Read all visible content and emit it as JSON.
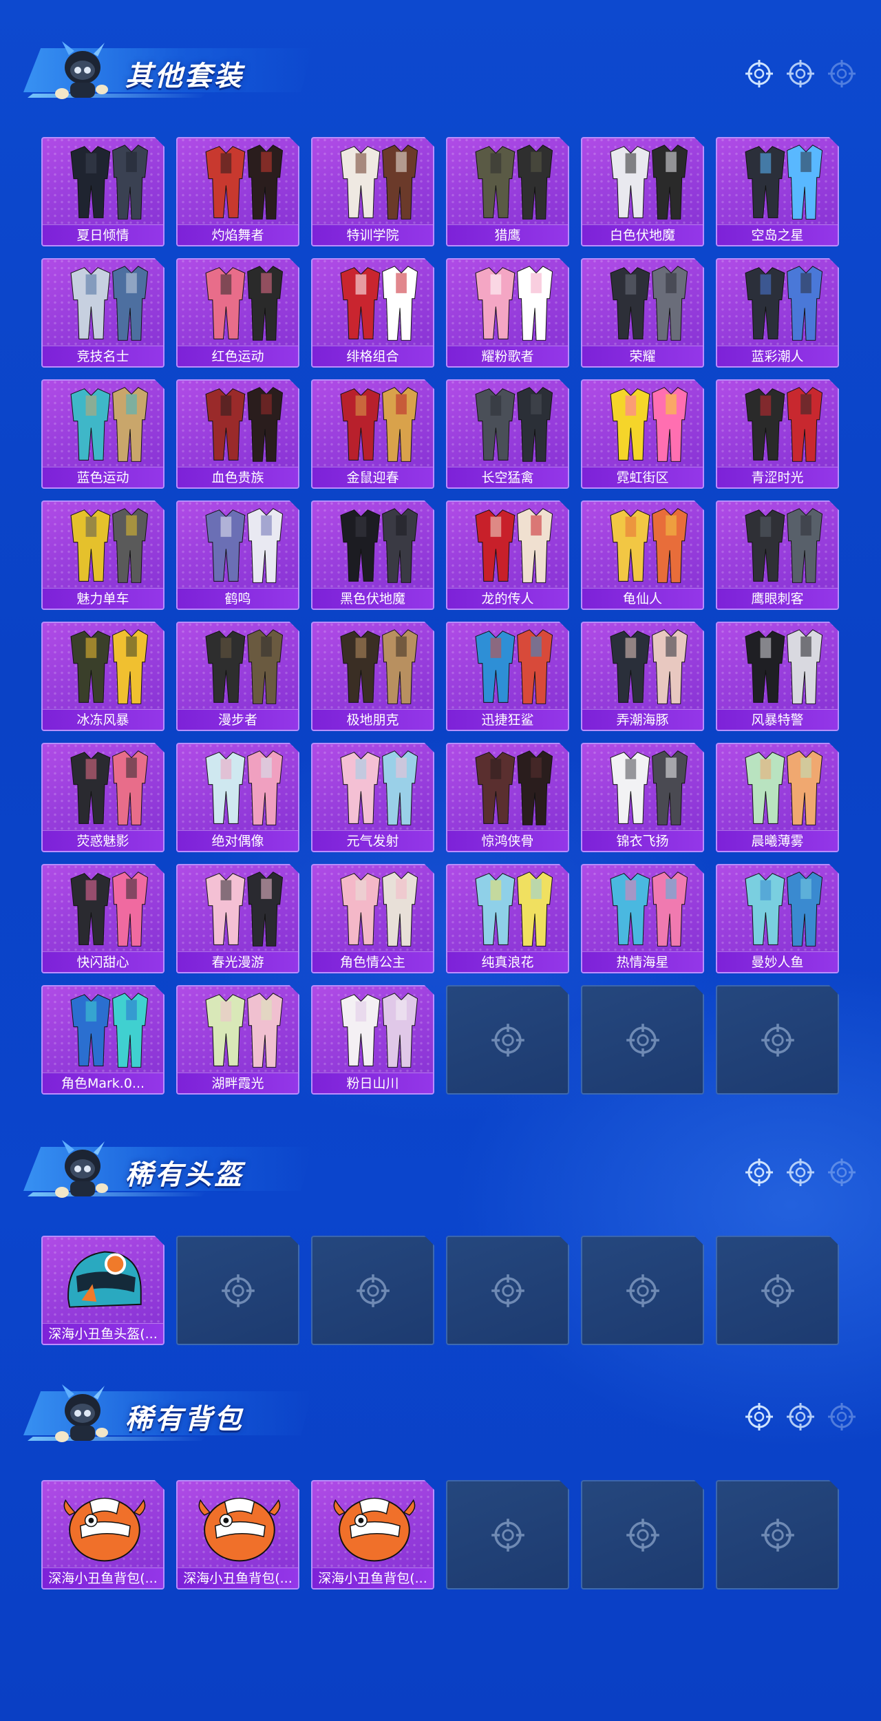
{
  "sections": [
    {
      "title": "其他套装",
      "items": [
        "夏日倾情",
        "灼焰舞者",
        "特训学院",
        "猎鹰",
        "白色伏地魔",
        "空岛之星",
        "竞技名士",
        "红色运动",
        "绯格组合",
        "耀粉歌者",
        "荣耀",
        "蓝彩潮人",
        "蓝色运动",
        "血色贵族",
        "金鼠迎春",
        "长空猛禽",
        "霓虹街区",
        "青涩时光",
        "魅力单车",
        "鹤鸣",
        "黑色伏地魔",
        "龙的传人",
        "龟仙人",
        "鹰眼刺客",
        "冰冻风暴",
        "漫步者",
        "极地朋克",
        "迅捷狂鲨",
        "弄潮海豚",
        "风暴特警",
        "荧惑魅影",
        "绝对偶像",
        "元气发射",
        "惊鸿侠骨",
        "锦衣飞扬",
        "晨曦薄雾",
        "快闪甜心",
        "春光漫游",
        "角色情公主",
        "纯真浪花",
        "热情海星",
        "曼妙人鱼",
        "角色Mark.0...",
        "湖畔霞光",
        "粉日山川"
      ],
      "empty_slots": 3
    },
    {
      "title": "稀有头盔",
      "items": [
        "深海小丑鱼头盔(..."
      ],
      "empty_slots": 5
    },
    {
      "title": "稀有背包",
      "items": [
        "深海小丑鱼背包(...",
        "深海小丑鱼背包(...",
        "深海小丑鱼背包(..."
      ],
      "empty_slots": 3
    }
  ],
  "colors": {
    "card_purple": "#9a3fdd",
    "label_purple": "#8a2de0",
    "empty_slot": "#1f3e74",
    "background_blue": "#0b45cc"
  },
  "icons": {
    "header": "crosshair-icon",
    "empty": "crosshair-icon",
    "mascot": "mascot-icon"
  }
}
